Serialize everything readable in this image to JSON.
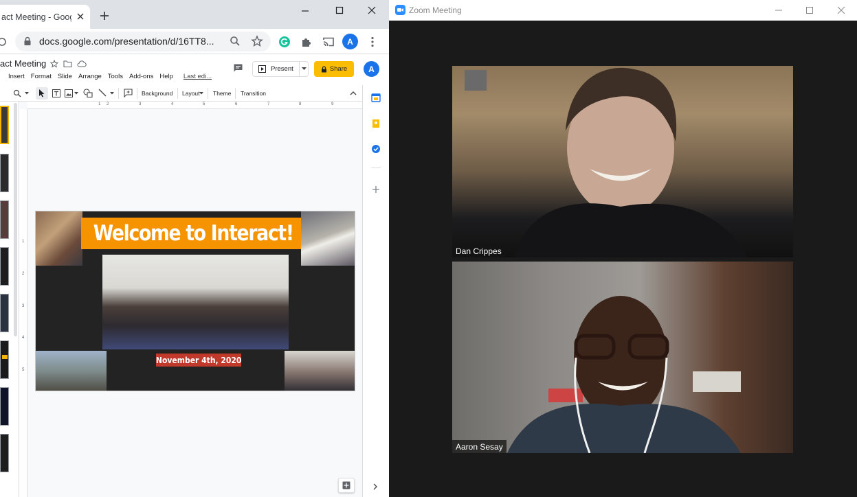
{
  "chrome": {
    "tab_title": "act Meeting - Goog",
    "url": "docs.google.com/presentation/d/16TT8...",
    "profile_initial": "A"
  },
  "slides_app": {
    "doc_title": "act Meeting",
    "menus": [
      "Insert",
      "Format",
      "Slide",
      "Arrange",
      "Tools",
      "Add-ons",
      "Help"
    ],
    "last_edit": "Last edi...",
    "present_label": "Present",
    "share_label": "Share",
    "user_initial": "A",
    "toolbar": {
      "background": "Background",
      "layout": "Layout",
      "theme": "Theme",
      "transition": "Transition"
    },
    "ruler_top": [
      "1",
      "2",
      "3",
      "4",
      "5",
      "6",
      "7",
      "8",
      "9"
    ],
    "ruler_left": [
      "1",
      "2",
      "3",
      "4",
      "5"
    ]
  },
  "slide": {
    "title": "Welcome to Interact!",
    "date": "November 4th, 2020",
    "colors": {
      "background": "#232323",
      "title_bg": "#f59300",
      "date_bg": "#c0392b"
    }
  },
  "zoom": {
    "window_title": "Zoom Meeting",
    "participants": [
      {
        "name": "Dan Crippes"
      },
      {
        "name": "Aaron Sesay"
      }
    ]
  }
}
